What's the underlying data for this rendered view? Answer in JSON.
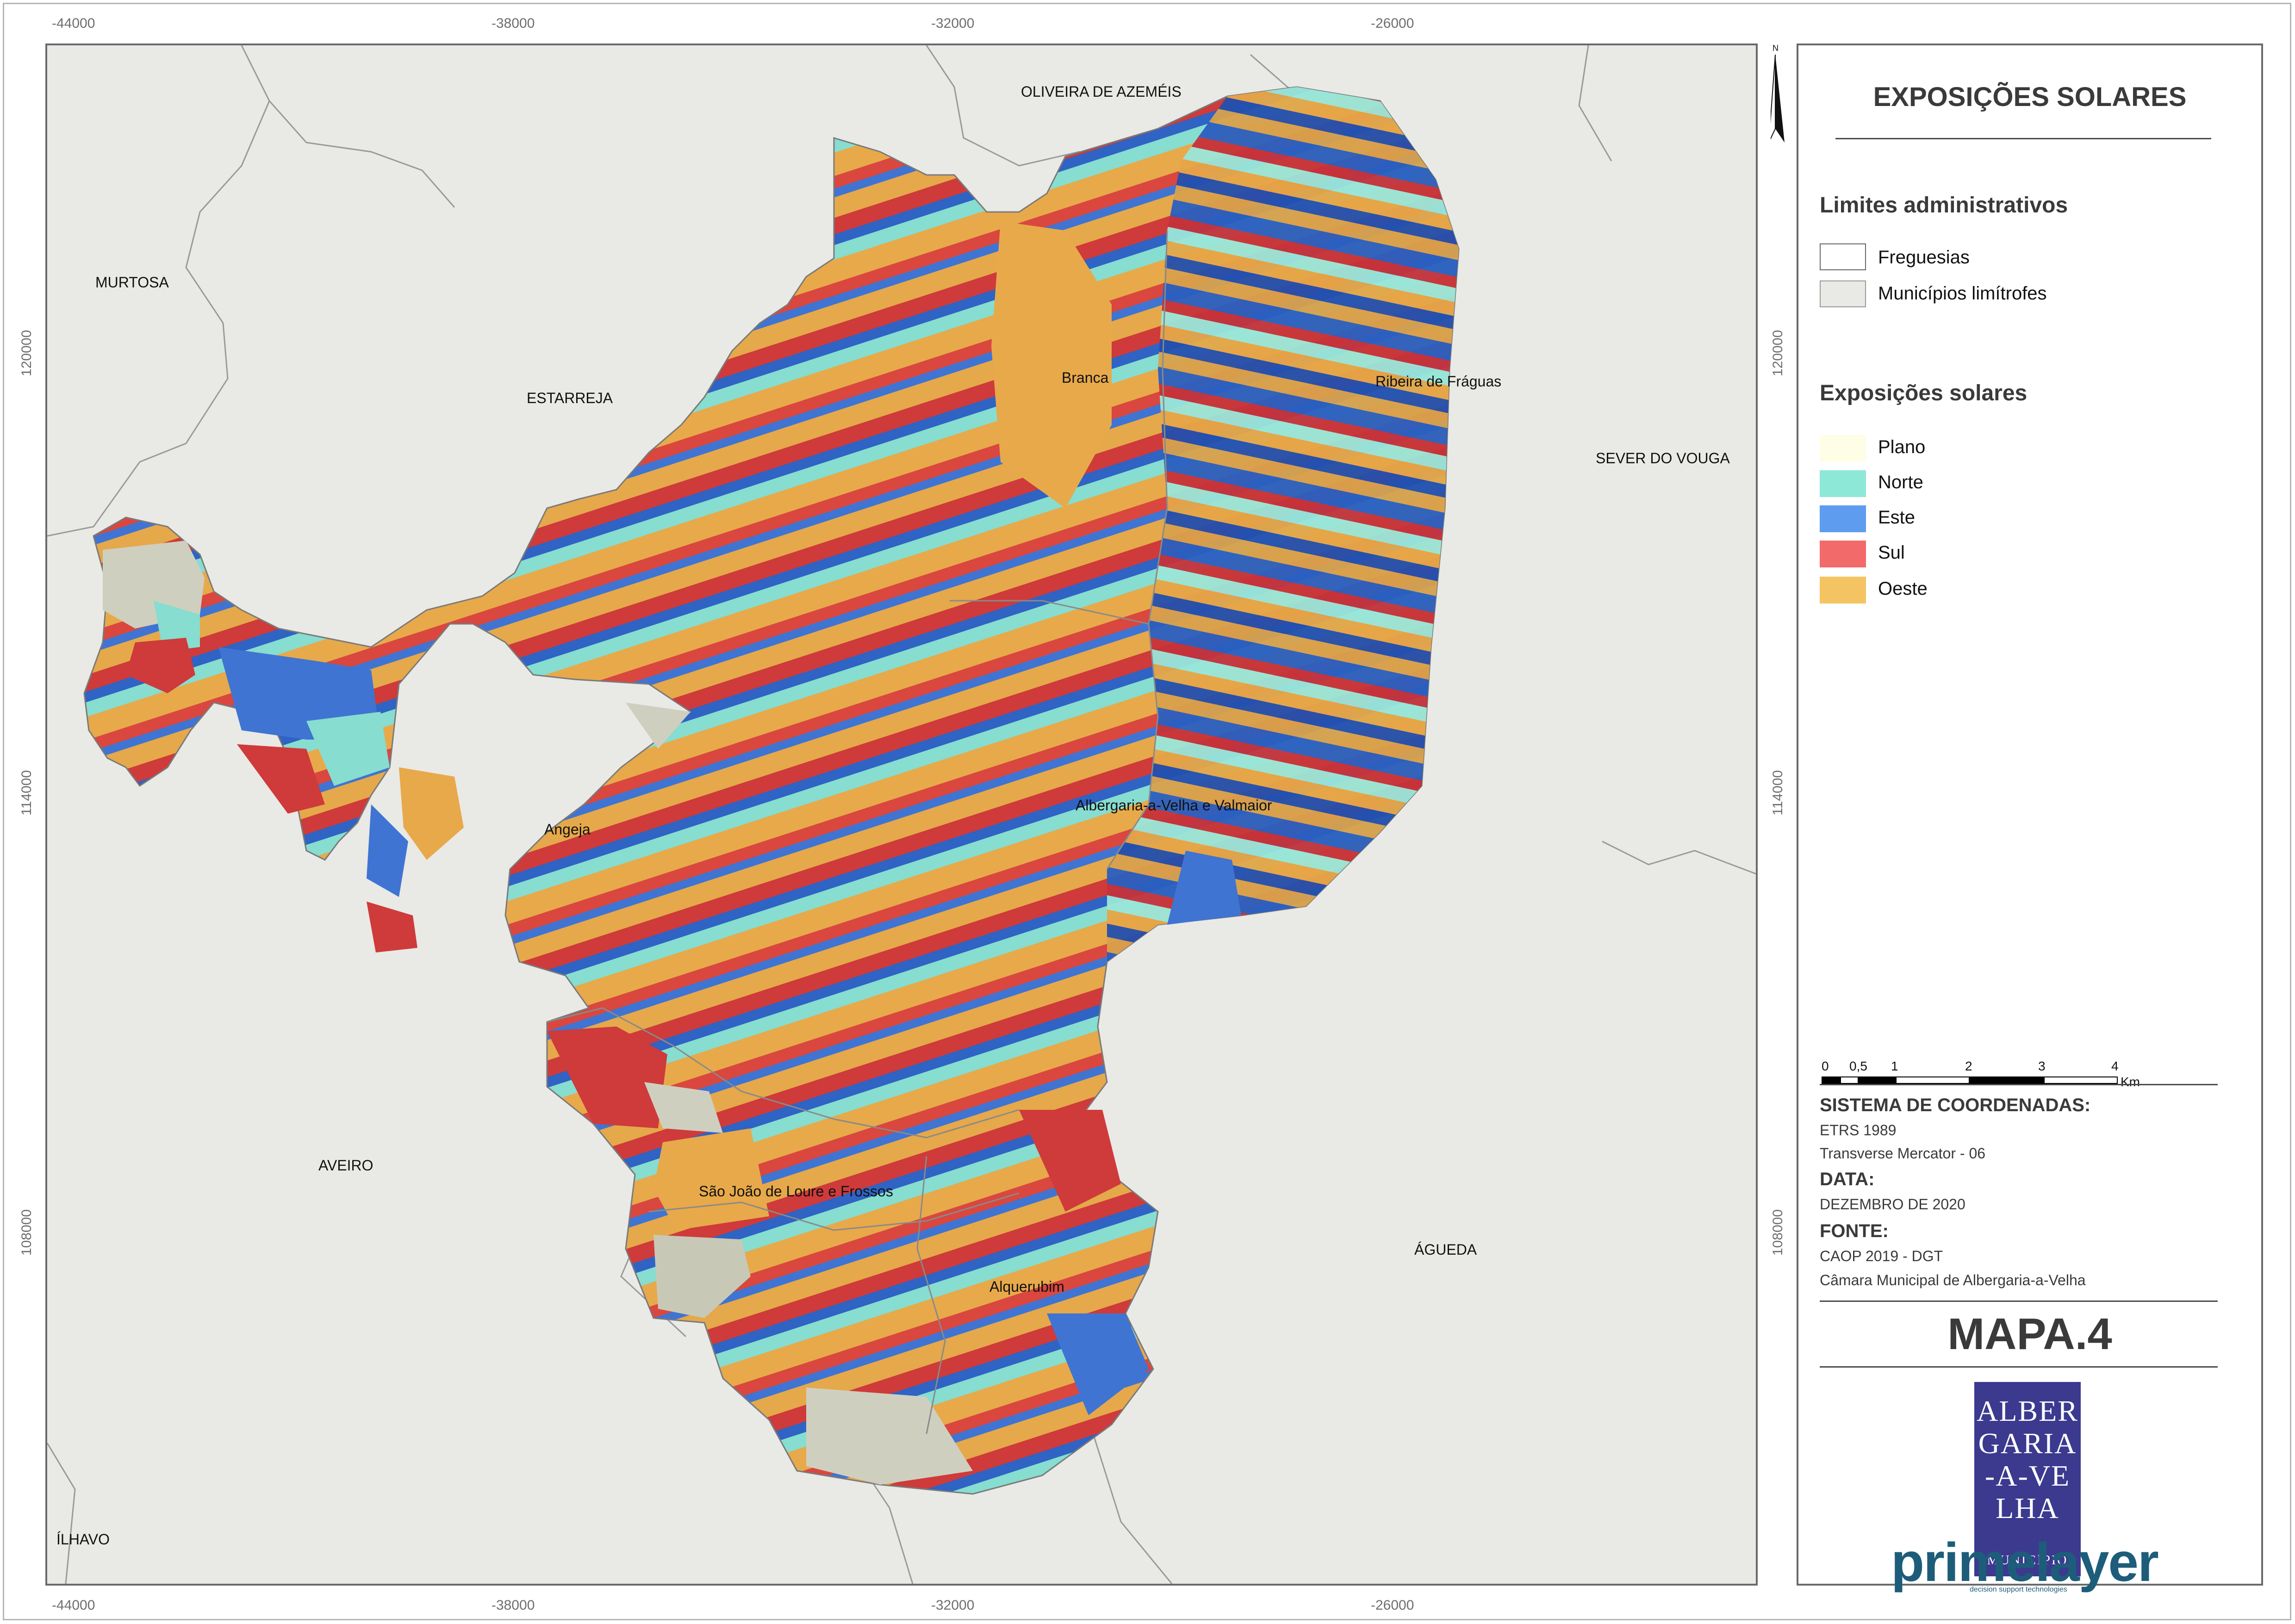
{
  "axes": {
    "x_ticks": [
      "-44000",
      "-38000",
      "-32000",
      "-26000"
    ],
    "y_ticks": [
      "120000",
      "114000",
      "108000"
    ]
  },
  "neighbors": [
    {
      "name": "OLIVEIRA DE AZEMÉIS"
    },
    {
      "name": "MURTOSA"
    },
    {
      "name": "ESTARREJA"
    },
    {
      "name": "SEVER DO VOUGA"
    },
    {
      "name": "AVEIRO"
    },
    {
      "name": "ÁGUEDA"
    },
    {
      "name": "ÍLHAVO"
    }
  ],
  "parishes": [
    {
      "name": "Branca"
    },
    {
      "name": "Ribeira de Fráguas"
    },
    {
      "name": "Albergaria-a-Velha e Valmaior"
    },
    {
      "name": "Angeja"
    },
    {
      "name": "São João de Loure e Frossos"
    },
    {
      "name": "Alquerubim"
    }
  ],
  "north_arrow": "N",
  "legend": {
    "title": "EXPOSIÇÕES SOLARES",
    "admin_heading": "Limites administrativos",
    "admin_items": [
      {
        "label": "Freguesias",
        "color": "#ffffff"
      },
      {
        "label": "Municípios limítrofes",
        "color": "#e9e9e5"
      }
    ],
    "exposure_heading": "Exposições solares",
    "exposure_items": [
      {
        "label": "Plano",
        "color": "#fefee6"
      },
      {
        "label": "Norte",
        "color": "#8ee8d8"
      },
      {
        "label": "Este",
        "color": "#5e9cf0"
      },
      {
        "label": "Sul",
        "color": "#f26a6a"
      },
      {
        "label": "Oeste",
        "color": "#f5c462"
      }
    ]
  },
  "scale_bar": {
    "labels": [
      "0",
      "0,5",
      "1",
      "2",
      "3",
      "4"
    ],
    "unit": "Km"
  },
  "info": {
    "coord_heading": "SISTEMA DE COORDENADAS:",
    "coord_lines": [
      "ETRS 1989",
      "Transverse Mercator - 06"
    ],
    "date_heading": "DATA:",
    "date_value": "DEZEMBRO DE 2020",
    "source_heading": "FONTE:",
    "source_lines": [
      "CAOP 2019 - DGT",
      "Câmara Municipal de Albergaria-a-Velha"
    ]
  },
  "map_number": "MAPA.4",
  "logo": {
    "municipality_lines": [
      "ALBER",
      "GARIA",
      "-A-VE",
      "LHA"
    ],
    "municipality_sub": "MUNICÍPIO",
    "company": "primelayer",
    "company_tagline": "decision support technologies"
  }
}
